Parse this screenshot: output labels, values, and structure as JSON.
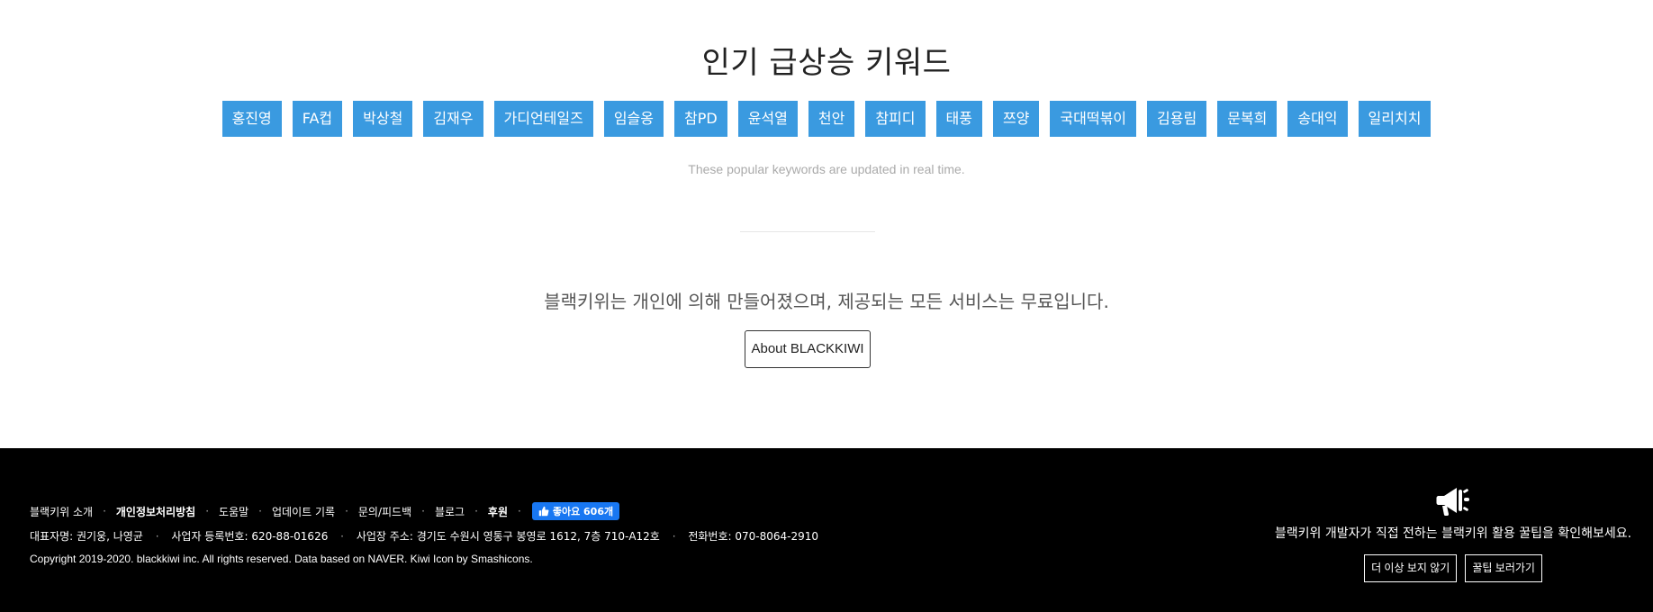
{
  "main": {
    "title": "인기 급상승 키워드",
    "keywords": [
      "홍진영",
      "FA컵",
      "박상철",
      "김재우",
      "가디언테일즈",
      "임슬옹",
      "참PD",
      "윤석열",
      "천안",
      "참피디",
      "태풍",
      "쯔양",
      "국대떡볶이",
      "김용림",
      "문복희",
      "송대익",
      "일리치치"
    ],
    "note": "These popular keywords are updated in real time.",
    "description": "블랙키위는 개인에 의해 만들어졌으며, 제공되는 모든 서비스는 무료입니다.",
    "about_button": "About BLACKKIWI"
  },
  "footer": {
    "links": {
      "intro": "블랙키위 소개",
      "privacy": "개인정보처리방침",
      "help": "도움말",
      "updates": "업데이트 기록",
      "feedback": "문의/피드백",
      "blog": "블로그",
      "sponsor": "후원"
    },
    "fb_like": "좋아요 606개",
    "business": {
      "ceo": "대표자명: 권기웅, 나영균",
      "reg": "사업자 등록번호: 620-88-01626",
      "address": "사업장 주소: 경기도 수원시 영통구 봉영로 1612, 7층 710-A12호",
      "phone": "전화번호: 070-8064-2910"
    },
    "copyright": "Copyright 2019-2020. blackkiwi inc. All rights reserved. Data based on NAVER. Kiwi Icon by Smashicons.",
    "tip": {
      "icon": "megaphone-icon",
      "text": "블랙키위 개발자가 직접 전하는 블랙키위 활용 꿀팁을 확인해보세요.",
      "dismiss_button": "더 이상 보지 않기",
      "view_button": "꿀팁 보러가기"
    }
  },
  "colors": {
    "keyword_bg": "#3a9ae0",
    "footer_bg": "#000000",
    "fb_blue": "#1877f2"
  }
}
